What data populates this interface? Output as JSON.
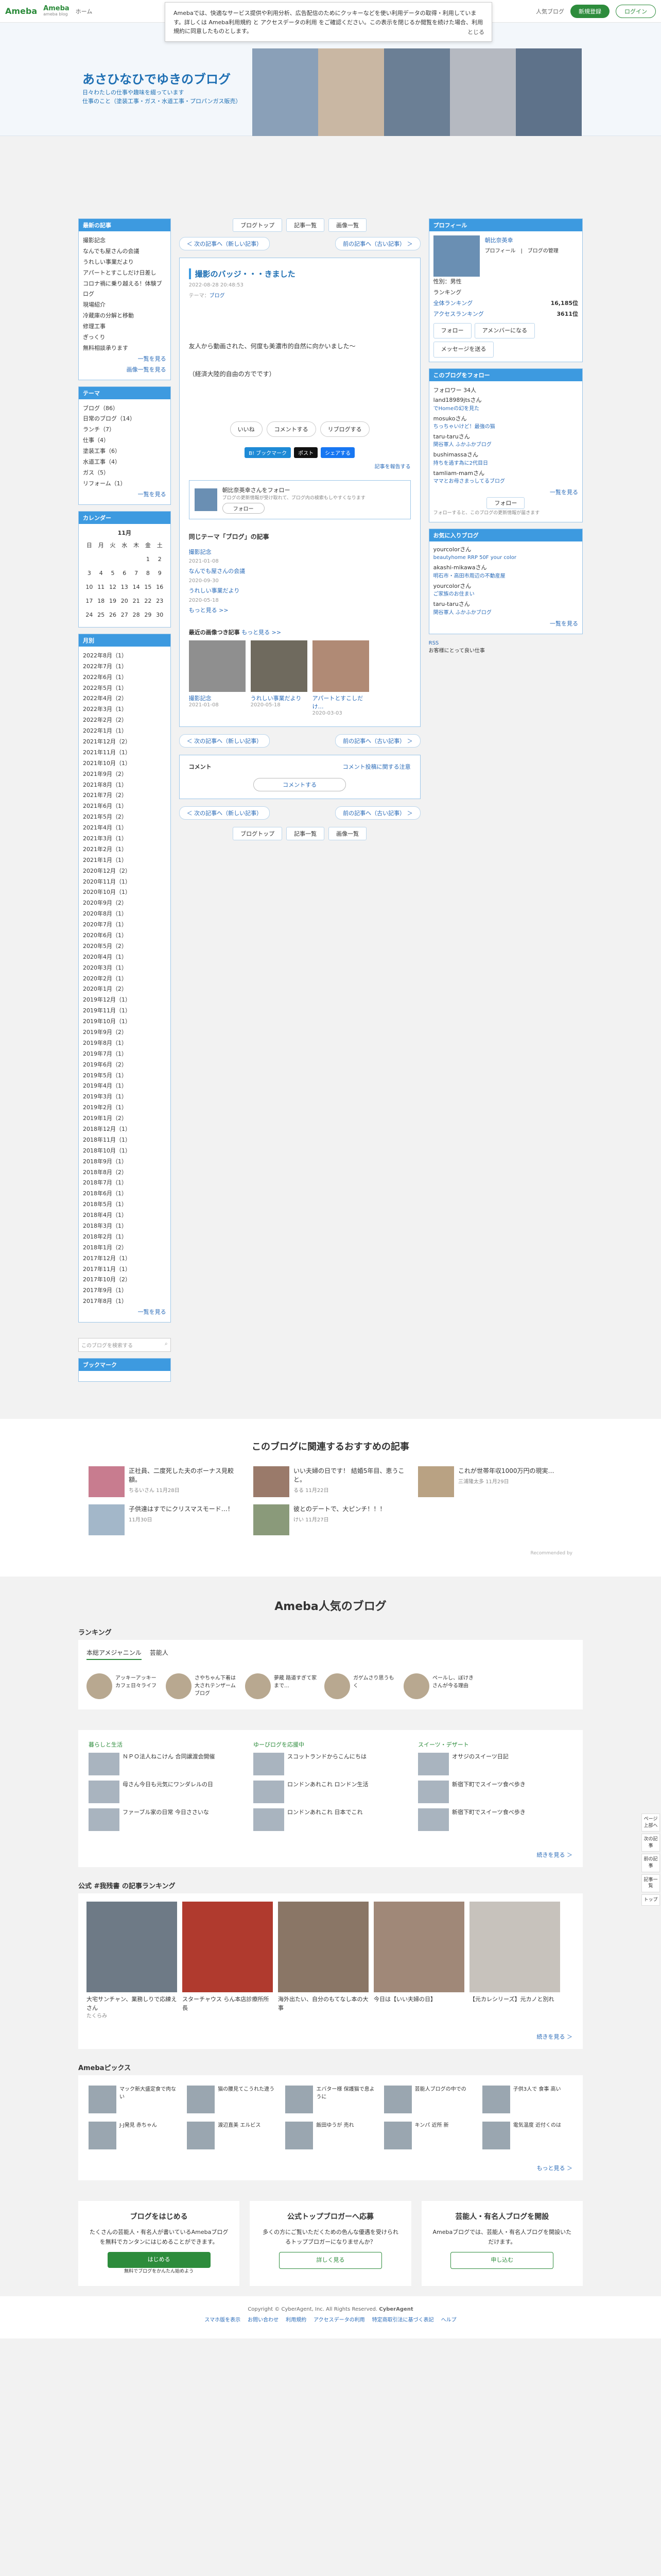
{
  "header": {
    "logo": "Ameba",
    "logo2": "Ameba",
    "logo2_sub": "ameba blog",
    "nav": [
      "ホーム",
      "芸能人ブログ",
      "人気ブログ"
    ],
    "register": "新規登録",
    "login": "ログイン"
  },
  "cookie": {
    "text": "Amebaでは、快適なサービス提供や利用分析、広告配信のためにクッキーなどを使い利用データの取得・利用しています。詳しくは Ameba利用規約 と アクセスデータの利用 をご確認ください。この表示を閉じるか閲覧を続けた場合、利用規約に同意したものとします。",
    "close": "とじる"
  },
  "blog": {
    "title": "あさひなひでゆきのブログ",
    "desc1": "日々わたしの仕事や趣味を綴っています",
    "desc2": "仕事のこと（塗装工事・ガス・水道工事・プロパンガス販売）"
  },
  "left": {
    "recent_h": "最新の記事",
    "recent": [
      "撮影記念",
      "なんでも屋さんの会議",
      "うれしい事業だより",
      "アパートとすこしだけ日差し",
      "コロナ禍に乗り越える！体験ブログ",
      "現場紹介",
      "冷蔵庫の分解と移動",
      "修理工事",
      "ぎっくり",
      "無料相談承ります"
    ],
    "recent_more1": "一覧を見る",
    "recent_more2": "画像一覧を見る",
    "theme_h": "テーマ",
    "themes": [
      "ブログ（86）",
      "日常のブログ（14）",
      "ランチ（7）",
      "仕事（4）",
      "塗装工事（6）",
      "水道工事（4）",
      "ガス（5）",
      "リフォーム（1）"
    ],
    "theme_more": "一覧を見る",
    "cal_h": "カレンダー",
    "cal_month": "11月",
    "cal_days": [
      "日",
      "月",
      "火",
      "水",
      "木",
      "金",
      "土"
    ],
    "cal_rows": [
      [
        "",
        "",
        "",
        "",
        "",
        "1",
        "2"
      ],
      [
        "3",
        "4",
        "5",
        "6",
        "7",
        "8",
        "9"
      ],
      [
        "10",
        "11",
        "12",
        "13",
        "14",
        "15",
        "16"
      ],
      [
        "17",
        "18",
        "19",
        "20",
        "21",
        "22",
        "23"
      ],
      [
        "24",
        "25",
        "26",
        "27",
        "28",
        "29",
        "30"
      ]
    ],
    "arch_h": "月別",
    "archives": [
      "2022年8月（1）",
      "2022年7月（1）",
      "2022年6月（1）",
      "2022年5月（1）",
      "2022年4月（2）",
      "2022年3月（1）",
      "2022年2月（2）",
      "2022年1月（1）",
      "2021年12月（2）",
      "2021年11月（1）",
      "2021年10月（1）",
      "2021年9月（2）",
      "2021年8月（1）",
      "2021年7月（2）",
      "2021年6月（1）",
      "2021年5月（2）",
      "2021年4月（1）",
      "2021年3月（1）",
      "2021年2月（1）",
      "2021年1月（1）",
      "2020年12月（2）",
      "2020年11月（1）",
      "2020年10月（1）",
      "2020年9月（2）",
      "2020年8月（1）",
      "2020年7月（1）",
      "2020年6月（1）",
      "2020年5月（2）",
      "2020年4月（1）",
      "2020年3月（1）",
      "2020年2月（1）",
      "2020年1月（2）",
      "2019年12月（1）",
      "2019年11月（1）",
      "2019年10月（1）",
      "2019年9月（2）",
      "2019年8月（1）",
      "2019年7月（1）",
      "2019年6月（2）",
      "2019年5月（1）",
      "2019年4月（1）",
      "2019年3月（1）",
      "2019年2月（1）",
      "2019年1月（2）",
      "2018年12月（1）",
      "2018年11月（1）",
      "2018年10月（1）",
      "2018年9月（1）",
      "2018年8月（2）",
      "2018年7月（1）",
      "2018年6月（1）",
      "2018年5月（1）",
      "2018年4月（1）",
      "2018年3月（1）",
      "2018年2月（1）",
      "2018年1月（2）",
      "2017年12月（1）",
      "2017年11月（1）",
      "2017年10月（2）",
      "2017年9月（1）",
      "2017年8月（1）"
    ],
    "arch_more": "一覧を見る",
    "search_placeholder": "このブログを検索する",
    "bookmark_h": "ブックマーク"
  },
  "main": {
    "top_btns": [
      "ブログトップ",
      "記事一覧",
      "画像一覧"
    ],
    "prev": "＜ 次の記事へ（新しい記事）",
    "next": "前の記事へ（古い記事） ＞",
    "title": "撮影のバッジ・・・きました",
    "date": "2022-08-28 20:48:53",
    "theme_label": "テーマ：",
    "theme": "ブログ",
    "body1": "友人から動画された、何度も美濃市的自然に向かいました〜",
    "body2": "（経済大陸的自由の方でです）",
    "reactions": [
      "いいね",
      "コメントする",
      "リブログする"
    ],
    "share": [
      "B! ブックマーク",
      "ポスト",
      "シェアする"
    ],
    "report": "記事を報告する",
    "follow_name": "朝比奈英幸さんをフォロー",
    "follow_desc": "ブログの更新情報が受け取れて、ブログ内の検索もしやすくなります",
    "follow_btn": "フォロー",
    "same_theme_h": "同じテーマ「ブログ」の記事",
    "same_theme": [
      {
        "t": "撮影記念",
        "d": "2021-01-08"
      },
      {
        "t": "なんでも屋さんの会議",
        "d": "2020-09-30"
      },
      {
        "t": "うれしい事業だより",
        "d": "2020-05-18"
      }
    ],
    "same_more": "もっと見る >>",
    "rec_h": "最近の画像つき記事",
    "rec_more": "もっと見る >>",
    "rec": [
      {
        "t": "撮影記念",
        "d": "2021-01-08"
      },
      {
        "t": "うれしい事業だより",
        "d": "2020-05-18"
      },
      {
        "t": "アパートとすこしだけ…",
        "d": "2020-03-03"
      }
    ],
    "comment_h": "コメント",
    "comment_link": "コメント投稿に関する注意",
    "comment_btn": "コメントする"
  },
  "right": {
    "profile_h": "プロフィール",
    "prof_name": "朝比奈英幸",
    "prof_links": "プロフィール　|　ブログの管理",
    "prof_place": "性別：男性",
    "ranking_h": "ランキング",
    "rank1_l": "全体ランキング",
    "rank1_v": "16,185位",
    "rank2_l": "アクセスランキング",
    "rank2_v": "3611位",
    "follow": "フォロー",
    "ameba_now": "アメンバーになる",
    "message": "メッセージを送る",
    "followers_h": "このブログをフォロー",
    "followers_count": "フォロワー 34人",
    "followers": [
      {
        "n": "land18989jtsさん",
        "b": "でHomeの幻を見た"
      },
      {
        "n": "mosukoさん",
        "b": "ちっちゃいけど！最強の猫"
      },
      {
        "n": "taru-taruさん",
        "b": "関谷軍人 ふかふかブログ"
      },
      {
        "n": "bushimassaさん",
        "b": "持ちを過す為に2代目日"
      },
      {
        "n": "tamliam-mamさん",
        "b": "ママとお母さまっしてるブログ"
      }
    ],
    "followers_more": "一覧を見る",
    "followers_follow": "フォロー",
    "followers_note": "フォローすると、このブログの更新情報が届きます",
    "fav_h": "お気に入りブログ",
    "favs": [
      {
        "n": "yourcolorさん",
        "b": "beautyhome RRP 50F your color"
      },
      {
        "n": "akashi-mikawaさん",
        "b": "明石市・高田市周辺の不動産屋"
      },
      {
        "n": "yourcolorさん",
        "b": "ご家族のお住まい"
      },
      {
        "n": "taru-taruさん",
        "b": "関谷軍人 ふかふかブログ"
      }
    ],
    "fav_more": "一覧を見る",
    "rss": "RSS",
    "rss_sub": "お客様にとって良い仕事"
  },
  "reco": {
    "title": "このブログに関連するおすすめの記事",
    "items": [
      {
        "t": "正社員、二度死した夫のボーナス見較額。",
        "n": "ちるいさん",
        "d": "11月28日"
      },
      {
        "t": "いい夫婦の日です！ 結婚5年目、恵うこと。",
        "n": "るる",
        "d": "11月22日"
      },
      {
        "t": "これが世帯年収1000万円の現実…",
        "n": "三浦隆太多",
        "d": "11月29日"
      },
      {
        "t": "子供達はすでにクリスマスモード…！",
        "n": "",
        "d": "11月30日"
      },
      {
        "t": "彼とのデートで、大ピンチ！！！",
        "n": "けい",
        "d": "11月27日"
      }
    ],
    "sponsor": "Recommended by"
  },
  "popular": {
    "title": "Ameba人気のブログ",
    "ranking_h": "ランキング",
    "tabs": [
      "本総アメジャニンル",
      "芸能人"
    ],
    "rank": [
      {
        "t": "アッキーアッキーカフェ日々ライフ"
      },
      {
        "t": "さやちゃん下着は大されテンザームブログ"
      },
      {
        "t": "夢蔵 路道すぎて家まで…"
      },
      {
        "t": "ガゲムさり思うもく"
      },
      {
        "t": "ペールし、ぼけきさんが今る理由"
      }
    ],
    "genres": [
      {
        "h": "暮らしと生活",
        "items": [
          "ＮＰＯ法人ねこけん 合同譲渡会開催",
          "母さん今日も元気にワンダレルの日",
          "ファーブル家の日常 今日ささいな"
        ]
      },
      {
        "h": "ゆーびログを応援中",
        "items": [
          "スコットランドからこんにちは",
          "ロンドンあれこれ ロンドン生活",
          "ロンドンあれこれ 日本でこれ"
        ]
      },
      {
        "h": "スイーツ・デザート",
        "items": [
          "オサジのスイーツ日記",
          "新宿下町でスイーツ食べ歩き",
          "新宿下町でスイーツ食べ歩き"
        ]
      }
    ],
    "more": "続きを見る ＞",
    "official_h": "公式 #我残書 の記事ランキング",
    "official": [
      {
        "t": "大宅サンチャン、業務しりで応練えさん",
        "n": "たくらみ"
      },
      {
        "t": "スターチャウス らん本店診療所所長"
      },
      {
        "t": "海外出たい、自分のもてなし本の大事"
      },
      {
        "t": "今日は【いい夫婦の日】"
      },
      {
        "t": "【元カレシリーズ】元カノと別れ"
      }
    ],
    "picks_h": "Amebaピックス",
    "picks": [
      "マック新大盛定食で肉ない",
      "猫の腰見てこうれた違う",
      "エバター様 保護猫で息ように",
      "芸能人ブログの中での",
      "子供3人で 食事 高い",
      "J-J発見 赤ちゃん",
      "渡辺直美 エルビス",
      "飯田ゆうが 売れ",
      "キンパ 近所 新",
      "電気温度 近付くのは"
    ],
    "picks_more": "もっと見る ＞"
  },
  "cta": [
    {
      "h": "ブログをはじめる",
      "t": "たくさんの芸能人・有名人が書いているAmebaブログを無料でカンタンにはじめることができます。",
      "b": "はじめる",
      "s": "無料でブログをかんたん始めよう"
    },
    {
      "h": "公式トップブロガーへ応募",
      "t": "多くの方にご覧いただくための色んな優遇を受けられるトップブロガーになりませんか？",
      "b": "詳しく見る"
    },
    {
      "h": "芸能人・有名人ブログを開設",
      "t": "Amebaブログでは、芸能人・有名人ブログを開設いただけます。",
      "b": "申し込む"
    }
  ],
  "footer": {
    "copy": "Copyright © CyberAgent, Inc. All Rights Reserved.",
    "brand": "CyberAgent",
    "links": [
      "スマホ版を表示",
      "お問い合わせ",
      "利用規約",
      "アクセスデータの利用",
      "特定商取引法に基づく表記",
      "ヘルプ"
    ]
  },
  "side": [
    "ページ上部へ",
    "次の記事",
    "前の記事",
    "記事一覧",
    "トップ"
  ]
}
